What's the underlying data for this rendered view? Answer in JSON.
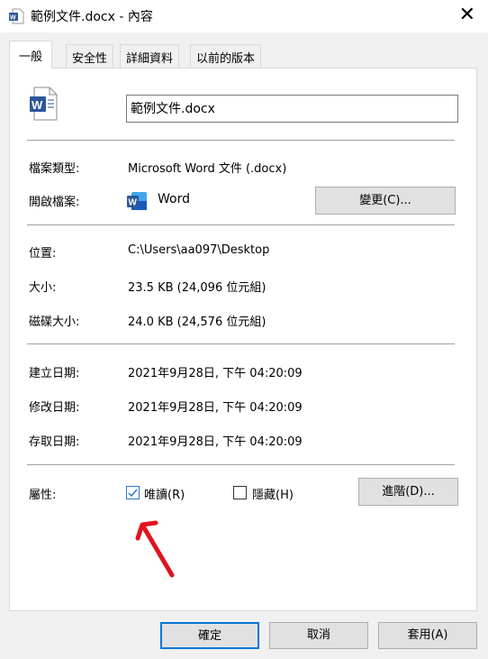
{
  "window": {
    "title": "範例文件.docx - 內容",
    "close_icon": "close-icon"
  },
  "tabs": [
    {
      "label": "一般",
      "active": true
    },
    {
      "label": "安全性"
    },
    {
      "label": "詳細資料"
    },
    {
      "label": "以前的版本"
    }
  ],
  "general": {
    "file_name": "範例文件.docx",
    "type_label": "檔案類型:",
    "type_value": "Microsoft Word 文件 (.docx)",
    "opens_label": "開啟檔案:",
    "opens_value": "Word",
    "change_button": "變更(C)...",
    "location_label": "位置:",
    "location_value": "C:\\Users\\aa097\\Desktop",
    "size_label": "大小:",
    "size_value": "23.5 KB (24,096 位元組)",
    "disk_size_label": "磁碟大小:",
    "disk_size_value": "24.0 KB (24,576 位元組)",
    "created_label": "建立日期:",
    "created_value": "2021年9月28日, 下午 04:20:09",
    "modified_label": "修改日期:",
    "modified_value": "2021年9月28日, 下午 04:20:09",
    "accessed_label": "存取日期:",
    "accessed_value": "2021年9月28日, 下午 04:20:09",
    "attributes_label": "屬性:",
    "readonly_label": "唯讀(R)",
    "readonly_checked": true,
    "hidden_label": "隱藏(H)",
    "hidden_checked": false,
    "advanced_button": "進階(D)..."
  },
  "footer": {
    "ok": "確定",
    "cancel": "取消",
    "apply": "套用(A)"
  },
  "colors": {
    "word_blue": "#2b579a",
    "annotation_arrow": "#e0141e",
    "check": "#2c74c9"
  }
}
